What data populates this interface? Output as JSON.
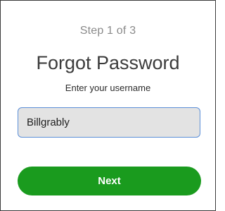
{
  "step_indicator": "Step 1 of 3",
  "title": "Forgot Password",
  "subtitle": "Enter your username",
  "username_field": {
    "value": "Billgrably"
  },
  "next_button": {
    "label": "Next"
  },
  "colors": {
    "button_background": "#1a9b1e",
    "input_background": "#e3e3e3",
    "input_focus_border": "#5b8fd8"
  }
}
